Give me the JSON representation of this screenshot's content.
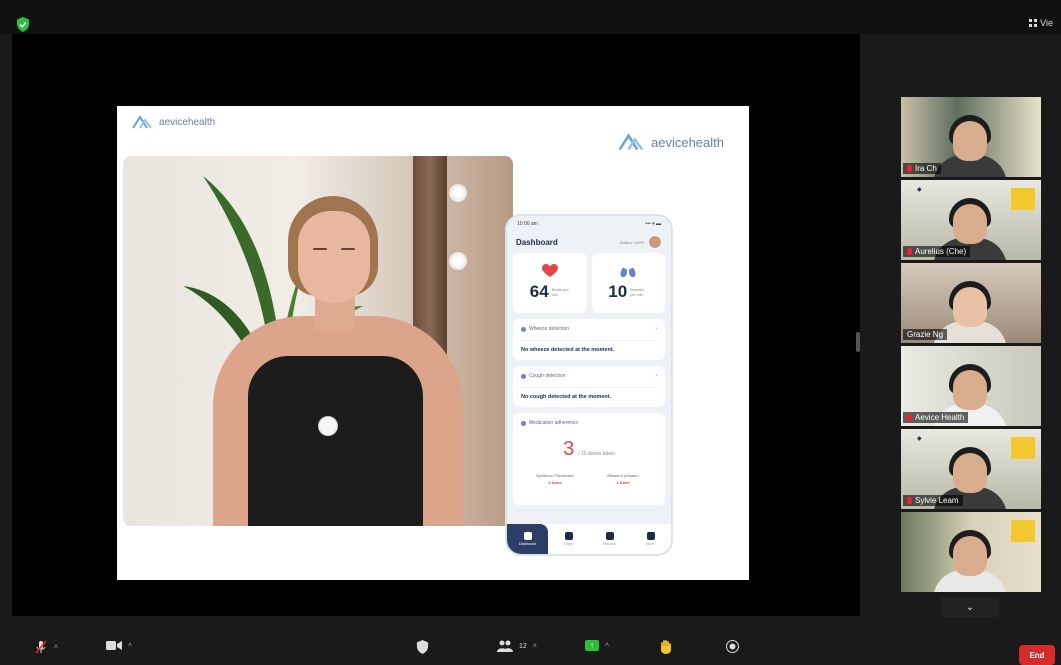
{
  "topbar": {
    "view_label": "Vie"
  },
  "slide": {
    "logo_small": "aevicehealth",
    "logo_large": "aevicehealth",
    "phone": {
      "status_left": "10:00 am",
      "status_right": "••• ▾ ▬",
      "dashboard_title": "Dashboard",
      "header_meta": "Battery 100%",
      "vitals": [
        {
          "value": "64",
          "unit": "Beats per min",
          "icon": "heart-icon",
          "color": "#e64545"
        },
        {
          "value": "10",
          "unit": "Breaths per min",
          "icon": "lungs-icon",
          "color": "#6a84c8"
        }
      ],
      "cards": [
        {
          "title": "Wheeze detection",
          "body": "No wheeze detected at the moment."
        },
        {
          "title": "Cough detection",
          "body": "No cough detected at the moment."
        }
      ],
      "medication": {
        "title": "Medication adherence",
        "count": "3",
        "total": "/ 10 doses taken",
        "stats": [
          {
            "label": "Symbicort Turbuhaler",
            "value": "2  Done"
          },
          {
            "label": "Albuterol (Inhaler)",
            "value": "1  Done"
          }
        ]
      },
      "nav": [
        "Dashboard",
        "Diary",
        "Records",
        "More"
      ]
    }
  },
  "gallery": {
    "participants": [
      {
        "name": "Ira Ch",
        "speaking": false,
        "mic_off": true,
        "bg": "#7a8a7a",
        "has_poster": false
      },
      {
        "name": "Aurelius (Che)",
        "speaking": false,
        "mic_off": true,
        "bg": "#cfcfc4",
        "has_poster": true
      },
      {
        "name": "Grazie Ng",
        "speaking": true,
        "mic_off": false,
        "bg": "#b4a89a",
        "has_poster": false
      },
      {
        "name": "Aevice Health",
        "speaking": false,
        "mic_off": true,
        "bg": "#d8d7cf",
        "has_poster": false
      },
      {
        "name": "Sylvie Leam",
        "speaking": false,
        "mic_off": true,
        "bg": "#cfcfc4",
        "has_poster": true
      },
      {
        "name": "",
        "speaking": false,
        "mic_off": false,
        "bg": "#c2b7a4",
        "has_poster": true
      }
    ],
    "next_label": "⌄"
  },
  "toolbar": {
    "participants_count": "12",
    "end_label": "End"
  },
  "colors": {
    "accent_green": "#29c03c",
    "end_red": "#d52b2b",
    "speaking_outline": "#a6d346"
  }
}
